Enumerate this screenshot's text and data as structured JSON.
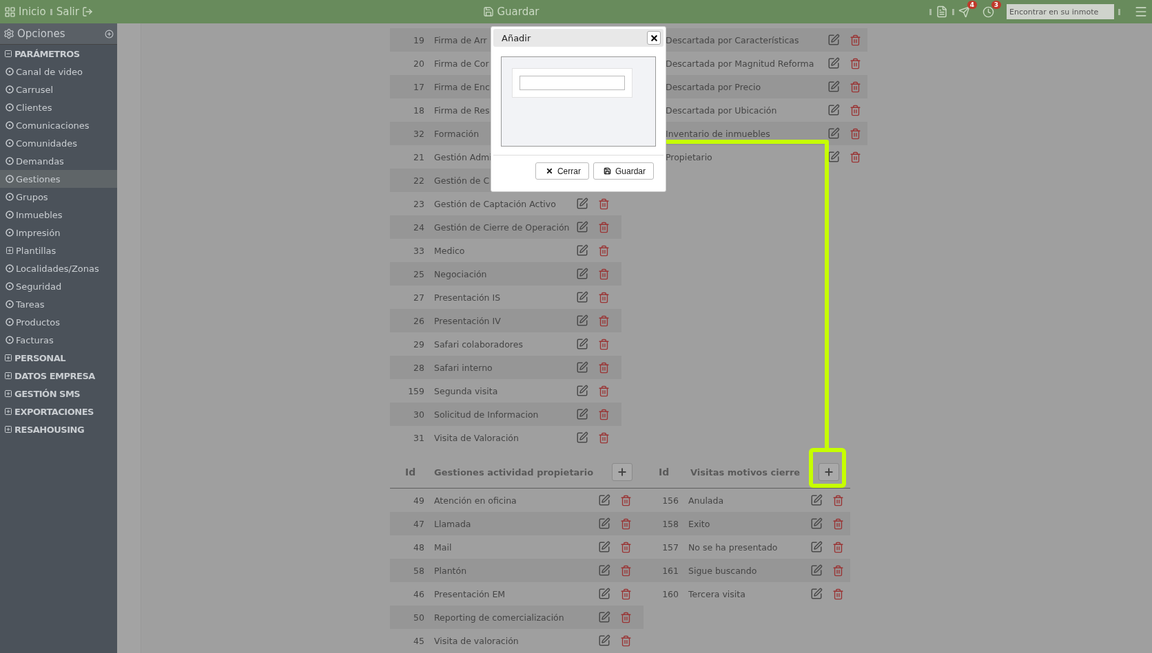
{
  "top_bar": {
    "home": "Inicio",
    "logout": "Salir",
    "save": "Guardar",
    "notifications": [
      {
        "kind": "messages",
        "count": "4"
      },
      {
        "kind": "reminders",
        "count": "3"
      }
    ],
    "search": {
      "placeholder": "Encontrar en su inmote"
    }
  },
  "sidebar": {
    "title": "Opciones",
    "sections": [
      {
        "label": "PARÁMETROS",
        "expanded": true,
        "children": [
          {
            "label": "Canal de video",
            "kind": "item",
            "selected": false
          },
          {
            "label": "Carrusel",
            "kind": "item",
            "selected": false
          },
          {
            "label": "Clientes",
            "kind": "item",
            "selected": false
          },
          {
            "label": "Comunicaciones",
            "kind": "item",
            "selected": false
          },
          {
            "label": "Comunidades",
            "kind": "item",
            "selected": false
          },
          {
            "label": "Demandas",
            "kind": "item",
            "selected": false
          },
          {
            "label": "Gestiones",
            "kind": "item",
            "selected": true
          },
          {
            "label": "Grupos",
            "kind": "item",
            "selected": false
          },
          {
            "label": "Inmuebles",
            "kind": "item",
            "selected": false
          },
          {
            "label": "Impresión",
            "kind": "item",
            "selected": false
          },
          {
            "label": "Plantillas",
            "kind": "group",
            "selected": false
          },
          {
            "label": "Localidades/Zonas",
            "kind": "item",
            "selected": false
          },
          {
            "label": "Seguridad",
            "kind": "item",
            "selected": false
          },
          {
            "label": "Tareas",
            "kind": "item",
            "selected": false
          },
          {
            "label": "Productos",
            "kind": "item",
            "selected": false
          },
          {
            "label": "Facturas",
            "kind": "item",
            "selected": false
          }
        ]
      },
      {
        "label": "PERSONAL",
        "expanded": false
      },
      {
        "label": "DATOS EMPRESA",
        "expanded": false
      },
      {
        "label": "GESTIÓN SMS",
        "expanded": false
      },
      {
        "label": "EXPORTACIONES",
        "expanded": false
      },
      {
        "label": "RESAHOUSING",
        "expanded": false
      }
    ]
  },
  "upper_tables": [
    {
      "rows": [
        {
          "id": "19",
          "name": "Firma de Arr"
        },
        {
          "id": "20",
          "name": "Firma de Cor"
        },
        {
          "id": "17",
          "name": "Firma de Enc"
        },
        {
          "id": "18",
          "name": "Firma de Res"
        },
        {
          "id": "32",
          "name": "Formación"
        },
        {
          "id": "21",
          "name": "Gestión Admi"
        },
        {
          "id": "22",
          "name": "Gestión de C"
        },
        {
          "id": "23",
          "name": "Gestión de Captación Activo"
        },
        {
          "id": "24",
          "name": "Gestión de Cierre de Operación"
        },
        {
          "id": "33",
          "name": "Medico"
        },
        {
          "id": "25",
          "name": "Negociación"
        },
        {
          "id": "27",
          "name": "Presentación IS"
        },
        {
          "id": "26",
          "name": "Presentación IV"
        },
        {
          "id": "29",
          "name": "Safari colaboradores"
        },
        {
          "id": "28",
          "name": "Safari interno"
        },
        {
          "id": "159",
          "name": "Segunda visita"
        },
        {
          "id": "30",
          "name": "Solicitud de Informacion"
        },
        {
          "id": "31",
          "name": "Visita de Valoración"
        }
      ]
    },
    {
      "rows": [
        {
          "name": "Descartada por Características"
        },
        {
          "name": "Descartada por Magnitud Reforma"
        },
        {
          "name": "Descartada por Precio"
        },
        {
          "name": "Descartada por Ubicación"
        },
        {
          "name": "Inventario de inmuebles"
        },
        {
          "name": "Propietario"
        }
      ]
    }
  ],
  "lower_tables": [
    {
      "columns": [
        "Id",
        "Gestiones actividad propietario"
      ],
      "rows": [
        {
          "id": "49",
          "name": "Atención en oficina"
        },
        {
          "id": "47",
          "name": "Llamada"
        },
        {
          "id": "48",
          "name": "Mail"
        },
        {
          "id": "58",
          "name": "Plantón"
        },
        {
          "id": "46",
          "name": "Presentación EM"
        },
        {
          "id": "50",
          "name": "Reporting de comercialización"
        },
        {
          "id": "45",
          "name": "Visita de valoración"
        }
      ]
    },
    {
      "columns": [
        "Id",
        "Visitas motivos cierre"
      ],
      "rows": [
        {
          "id": "156",
          "name": "Anulada"
        },
        {
          "id": "158",
          "name": "Exito"
        },
        {
          "id": "157",
          "name": "No se ha presentado"
        },
        {
          "id": "161",
          "name": "Sigue buscando"
        },
        {
          "id": "160",
          "name": "Tercera visita"
        }
      ]
    }
  ],
  "dialog": {
    "title": "Añadir",
    "buttons": [
      {
        "kind": "close",
        "label": "Cerrar"
      },
      {
        "kind": "save",
        "label": "Guardar"
      }
    ]
  }
}
